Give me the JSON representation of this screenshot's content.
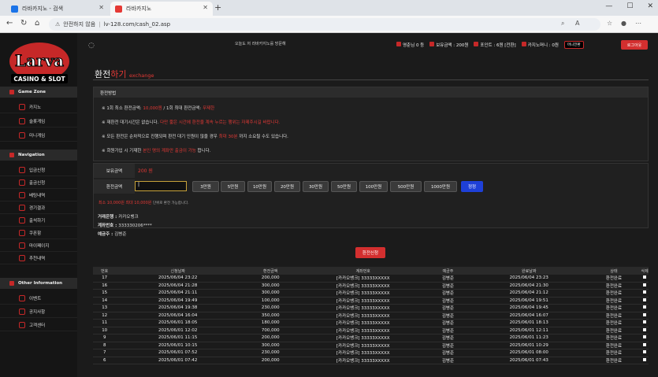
{
  "browser": {
    "tabs": [
      {
        "title": "라바카지노 - 검색",
        "favicon_color": "#1a73e8"
      },
      {
        "title": "라바카지노",
        "favicon_color": "#e53935"
      }
    ],
    "not_secure": "안전하지 않음",
    "url": "lv-128.com/cash_02.asp"
  },
  "logo": {
    "top": "Larva",
    "bottom": "CASINO & SLOT"
  },
  "sidebar": {
    "game_zone": {
      "title": "Game Zone",
      "items": [
        "카지노",
        "슬롯게임",
        "미니게임"
      ]
    },
    "navigation": {
      "title": "Navigation",
      "items": [
        "입금신청",
        "출금신청",
        "베팅내역",
        "경기결과",
        "출석하기",
        "쿠폰함",
        "마이페이지",
        "추천내역"
      ]
    },
    "other": {
      "title": "Other Information",
      "items": [
        "이벤트",
        "공지사항",
        "고객센터"
      ]
    }
  },
  "topbar": {
    "notice": "오늘도 저 라바카지노를 방문해",
    "user": "영춘님",
    "level": "0 등",
    "holding_label": "보유금액",
    "holding_value": "200원",
    "points_label": "포인트",
    "points_value": "6원 [전환]",
    "casino_money_label": "카지노머니",
    "casino_money_value": "0원",
    "mini_label": "머니전환",
    "logout": "로그아웃"
  },
  "page_title": {
    "ko_white": "환전",
    "ko_red": "하기",
    "en": "exchange"
  },
  "info": {
    "header": "환전방법",
    "rows": [
      {
        "a": "※ 1회 최소 환전금액: ",
        "r1": "10,000원",
        "b": " / 1회 최대 환전금액: ",
        "r2": "무제한",
        "c": ""
      },
      {
        "a": "※ 재환전 대기시간은 없습니다. ",
        "r1": "다만 짧은 시간에 환전을 계속 누르는 행위는 자제주시길 바랍니다.",
        "b": "",
        "r2": "",
        "c": ""
      },
      {
        "a": "※ 모든 환전은 순차적으로 진행되며 환전 대기 인원이 많을 경우 ",
        "r1": "최대 30분",
        "b": " 까지 소요될 수도 있습니다.",
        "r2": "",
        "c": ""
      },
      {
        "a": "※ 회원가입 시 기재한 ",
        "r1": "본인 명의 계좌만 출금이 가능",
        "b": " 합니다.",
        "r2": "",
        "c": ""
      }
    ]
  },
  "exchange": {
    "balance_label": "보유금액",
    "balance_value": "200 원",
    "amount_label": "환전금액",
    "amount_value": "|",
    "buttons": [
      "3만원",
      "5만원",
      "10만원",
      "20만원",
      "30만원",
      "50만원",
      "100만원",
      "500만원",
      "1000만원"
    ],
    "reset": "정정",
    "note_main": "최소 10,000원 최대 10,000원",
    "note_sub": "단위로 환전 가능합니다."
  },
  "bank": {
    "bank_label": "거래은행 : ",
    "bank_value": "카카오뱅크",
    "account_label": "계좌번호 : ",
    "account_value": "333330206****",
    "holder_label": "예금주 : ",
    "holder_value": "김병준"
  },
  "submit": "환전신청",
  "table": {
    "headers": [
      "번호",
      "신청날짜",
      "환전금액",
      "계좌번호",
      "예금주",
      "완료날짜",
      "상태",
      "삭제"
    ],
    "rows": [
      [
        "17",
        "2025/06/04 23:22",
        "200,000",
        "[카카오뱅크] 33333XXXXX",
        "김병준",
        "2025/06/04 23:23",
        "환전완료"
      ],
      [
        "16",
        "2025/06/04 21:28",
        "300,000",
        "[카카오뱅크] 33333XXXXX",
        "김병준",
        "2025/06/04 21:30",
        "환전완료"
      ],
      [
        "15",
        "2025/06/04 21:11",
        "300,000",
        "[카카오뱅크] 33333XXXXX",
        "김병준",
        "2025/06/04 21:12",
        "환전완료"
      ],
      [
        "14",
        "2025/06/04 19:49",
        "100,000",
        "[카카오뱅크] 33333XXXXX",
        "김병준",
        "2025/06/04 19:51",
        "환전완료"
      ],
      [
        "13",
        "2025/06/04 19:38",
        "230,000",
        "[카카오뱅크] 33333XXXXX",
        "김병준",
        "2025/06/04 19:45",
        "환전완료"
      ],
      [
        "12",
        "2025/06/04 16:04",
        "350,000",
        "[카카오뱅크] 33333XXXXX",
        "김병준",
        "2025/06/04 16:07",
        "환전완료"
      ],
      [
        "11",
        "2025/06/01 18:05",
        "180,000",
        "[카카오뱅크] 33333XXXXX",
        "김병준",
        "2025/06/01 18:13",
        "환전완료"
      ],
      [
        "10",
        "2025/06/01 12:02",
        "700,000",
        "[카카오뱅크] 33333XXXXX",
        "김병준",
        "2025/06/01 12:11",
        "환전완료"
      ],
      [
        "9",
        "2025/06/01 11:15",
        "200,000",
        "[카카오뱅크] 33333XXXXX",
        "김병준",
        "2025/06/01 11:23",
        "환전완료"
      ],
      [
        "8",
        "2025/06/01 10:15",
        "300,000",
        "[카카오뱅크] 33333XXXXX",
        "김병준",
        "2025/06/01 10:29",
        "환전완료"
      ],
      [
        "7",
        "2025/06/01 07:52",
        "230,000",
        "[카카오뱅크] 33333XXXXX",
        "김병준",
        "2025/06/01 08:00",
        "환전완료"
      ],
      [
        "6",
        "2025/06/01 07:42",
        "200,000",
        "[카카오뱅크] 33333XXXXX",
        "김병준",
        "2025/06/01 07:43",
        "환전완료"
      ]
    ]
  }
}
